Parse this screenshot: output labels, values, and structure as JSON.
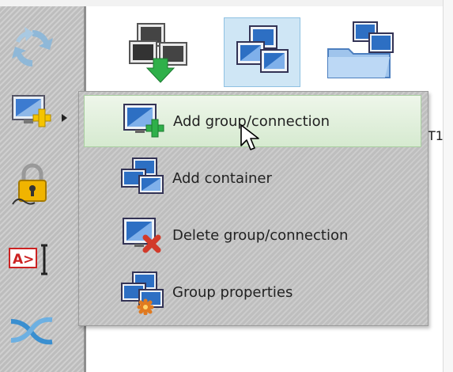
{
  "background_label": "T1",
  "context_menu": {
    "items": [
      {
        "label": "Add group/connection",
        "icon": "add-group-icon"
      },
      {
        "label": "Add container",
        "icon": "container-icon"
      },
      {
        "label": "Delete group/connection",
        "icon": "delete-group-icon"
      },
      {
        "label": "Group properties",
        "icon": "group-properties-icon"
      }
    ],
    "hovered_index": 0
  },
  "sidebar": {
    "items": [
      {
        "icon": "refresh-icon"
      },
      {
        "icon": "add-monitor-icon"
      },
      {
        "icon": "lock-icon"
      },
      {
        "icon": "rename-icon",
        "text": "A>"
      },
      {
        "icon": "shuffle-icon"
      }
    ]
  },
  "icon_view": {
    "items": [
      {
        "icon": "download-computers-icon"
      },
      {
        "icon": "group-icon",
        "selected": true
      },
      {
        "icon": "folder-computers-icon"
      }
    ]
  },
  "colors": {
    "accent_blue": "#2d6fc3",
    "hover_green": "#d6ead0",
    "delete_red": "#d23a2a",
    "add_green": "#2fb04a"
  }
}
